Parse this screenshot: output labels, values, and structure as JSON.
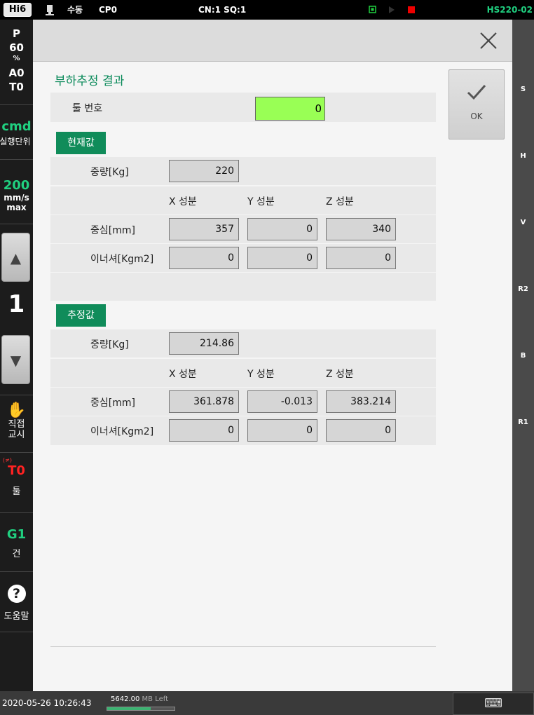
{
  "status_bar": {
    "badge": "Hi6",
    "mode": "수동",
    "program": "CP0",
    "cn_sq": "CN:1 SQ:1",
    "model": "HS220-02"
  },
  "left_panel": {
    "p_label": "P",
    "p_value": "60",
    "p_unit": "%",
    "a_label": "A0",
    "t_label": "T0",
    "cmd": "cmd",
    "cmd_sub": "실행단위",
    "speed": "200",
    "speed_unit1": "mm/s",
    "speed_unit2": "max",
    "step": "1",
    "teach_label1": "직접",
    "teach_label2": "교시",
    "tool_tiny": "(≠)",
    "tool_value": "T0",
    "tool_label": "툴",
    "gun_value": "G1",
    "gun_label": "건",
    "help_icon": "?",
    "help_label": "도움말"
  },
  "right_panel": [
    "S",
    "H",
    "V",
    "R2",
    "B",
    "R1"
  ],
  "bottom_bar": {
    "datetime": "2020-05-26 10:26:43",
    "memory": "5642.00",
    "memory_unit": "MB Left",
    "memory_fraction": 0.65
  },
  "dialog": {
    "title": "부하추정 결과",
    "ok_label": "OK",
    "tool_number_label": "툴 번호",
    "tool_number_value": "0",
    "current": {
      "badge": "현재값",
      "weight_label": "중량[Kg]",
      "weight": "220",
      "col_x": "X 성분",
      "col_y": "Y 성분",
      "col_z": "Z 성분",
      "center_label": "중심[mm]",
      "center_x": "357",
      "center_y": "0",
      "center_z": "340",
      "inertia_label": "이너셔[Kgm2]",
      "inertia_x": "0",
      "inertia_y": "0",
      "inertia_z": "0"
    },
    "estimated": {
      "badge": "추정값",
      "weight_label": "중량[Kg]",
      "weight": "214.86",
      "col_x": "X 성분",
      "col_y": "Y 성분",
      "col_z": "Z 성분",
      "center_label": "중심[mm]",
      "center_x": "361.878",
      "center_y": "-0.013",
      "center_z": "383.214",
      "inertia_label": "이너셔[Kgm2]",
      "inertia_x": "0",
      "inertia_y": "0",
      "inertia_z": "0"
    }
  }
}
